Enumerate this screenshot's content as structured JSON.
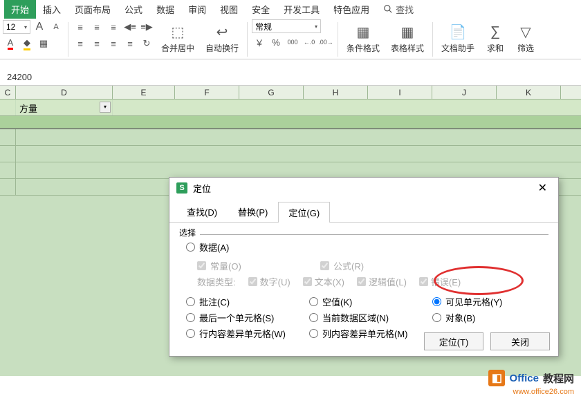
{
  "menu": {
    "tabs": [
      "开始",
      "插入",
      "页面布局",
      "公式",
      "数据",
      "审阅",
      "视图",
      "安全",
      "开发工具",
      "特色应用"
    ],
    "search": "查找"
  },
  "ribbon": {
    "font_size": "12",
    "big_a": "A",
    "small_a": "A",
    "merge_center": "合并居中",
    "auto_wrap": "自动换行",
    "number_format": "常规",
    "currency": "￥",
    "percent": "%",
    "comma": "000",
    "inc_dec": ".0",
    "dec_dec": ".00",
    "cond_format": "条件格式",
    "table_style": "表格样式",
    "doc_helper": "文档助手",
    "sum": "求和",
    "sigma": "∑",
    "filter": "筛选"
  },
  "formula_bar": {
    "value": "24200"
  },
  "columns": [
    "C",
    "D",
    "E",
    "F",
    "G",
    "H",
    "I",
    "J",
    "K"
  ],
  "filter_label": "方量",
  "dialog": {
    "title": "定位",
    "tabs": {
      "find": "查找(D)",
      "replace": "替换(P)",
      "goto": "定位(G)"
    },
    "select_label": "选择",
    "options": {
      "data": "数据(A)",
      "constant": "常量(O)",
      "formula": "公式(R)",
      "data_type": "数据类型:",
      "number": "数字(U)",
      "text": "文本(X)",
      "logical": "逻辑值(L)",
      "error": "错误(E)",
      "comment": "批注(C)",
      "blank": "空值(K)",
      "visible": "可见单元格(Y)",
      "last": "最后一个单元格(S)",
      "current_region": "当前数据区域(N)",
      "object": "对象(B)",
      "row_diff": "行内容差异单元格(W)",
      "col_diff": "列内容差异单元格(M)"
    },
    "buttons": {
      "goto": "定位(T)",
      "close": "关闭"
    }
  },
  "watermark": {
    "txt1": "Office",
    "txt2": "教程网",
    "url": "www.office26.com"
  }
}
